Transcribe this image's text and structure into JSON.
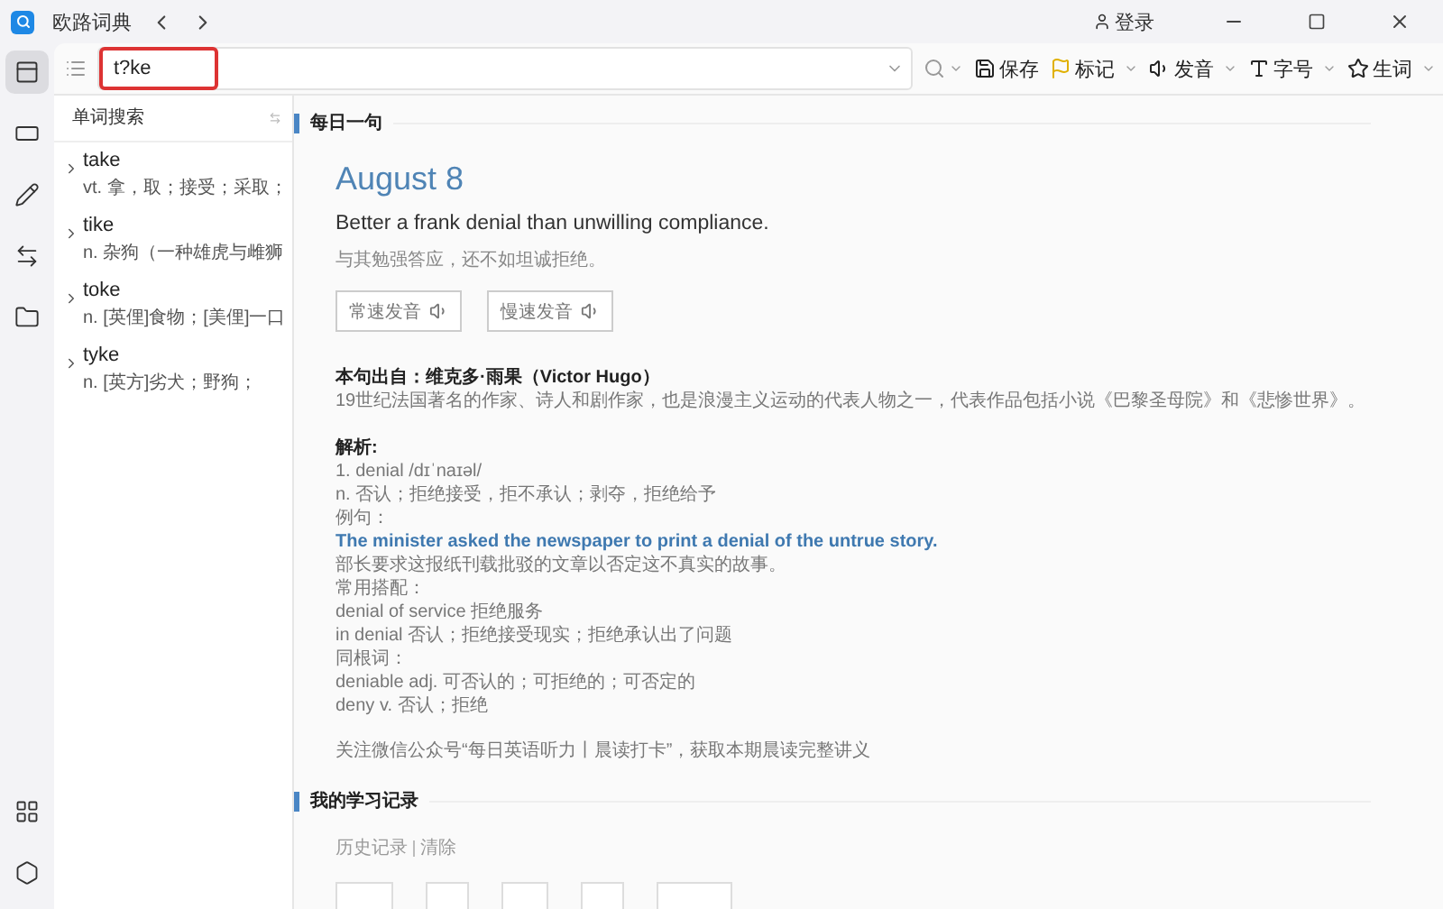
{
  "titlebar": {
    "app_name": "欧路词典",
    "login": "登录"
  },
  "rail": {
    "top": [
      {
        "kind": "panel",
        "selected": true
      },
      {
        "kind": "card",
        "selected": false
      },
      {
        "kind": "pencil",
        "selected": false
      },
      {
        "kind": "swap",
        "selected": false
      },
      {
        "kind": "folder",
        "selected": false
      }
    ],
    "bottom": [
      {
        "kind": "grid",
        "selected": false
      },
      {
        "kind": "settings",
        "selected": false
      }
    ]
  },
  "search": {
    "value": "t?ke"
  },
  "toolbar": [
    {
      "kind": "save",
      "label": "保存",
      "dropdown": false
    },
    {
      "kind": "flag",
      "label": "标记",
      "dropdown": true
    },
    {
      "kind": "speaker",
      "label": "发音",
      "dropdown": true
    },
    {
      "kind": "font",
      "label": "字号",
      "dropdown": true
    },
    {
      "kind": "star",
      "label": "生词",
      "dropdown": true
    }
  ],
  "word_list": {
    "title": "单词搜索",
    "items": [
      {
        "word": "take",
        "definition": "vt. 拿，取；接受；采取；",
        "expanded": false
      },
      {
        "word": "tike",
        "definition": "n. 杂狗（一种雄虎与雌狮",
        "expanded": false
      },
      {
        "word": "toke",
        "definition": "n. [英俚]食物；[美俚]一口",
        "expanded": false
      },
      {
        "word": "tyke",
        "definition": "n. [英方]劣犬；野狗；",
        "expanded": false
      }
    ]
  },
  "daily": {
    "heading": "每日一句",
    "date": "August 8",
    "sentence": "Better a frank denial than unwilling compliance.",
    "translation": "与其勉强答应，还不如坦诚拒绝。",
    "audio_buttons": [
      "常速发音",
      "慢速发音"
    ],
    "source": "本句出自：维克多·雨果（Victor Hugo）",
    "source_note": "19世纪法国著名的作家、诗人和剧作家，也是浪漫主义运动的代表人物之一，代表作品包括小说《巴黎圣母院》和《悲惨世界》。",
    "analysis_title": "解析:",
    "analysis": [
      {
        "kind": "plain",
        "text": "1. denial /dɪˈnaɪəl/"
      },
      {
        "kind": "plain",
        "text": "n. 否认；拒绝接受，拒不承认；剥夺，拒绝给予"
      },
      {
        "kind": "plain",
        "text": "例句："
      },
      {
        "kind": "example",
        "text": "The minister asked the newspaper to print a denial of the untrue story."
      },
      {
        "kind": "plain",
        "text": "部长要求这报纸刊载批驳的文章以否定这不真实的故事。"
      },
      {
        "kind": "plain",
        "text": "常用搭配："
      },
      {
        "kind": "plain",
        "text": "denial of service 拒绝服务"
      },
      {
        "kind": "plain",
        "text": "in denial 否认；拒绝接受现实；拒绝承认出了问题"
      },
      {
        "kind": "plain",
        "text": "同根词："
      },
      {
        "kind": "plain",
        "text": "deniable adj. 可否认的；可拒绝的；可否定的"
      },
      {
        "kind": "plain",
        "text": "deny v. 否认；拒绝"
      }
    ],
    "footer_note": "关注微信公众号“每日英语听力丨晨读打卡”，获取本期晨读完整讲义"
  },
  "records": {
    "heading": "我的学习记录",
    "links": [
      "历史记录",
      "清除"
    ]
  }
}
